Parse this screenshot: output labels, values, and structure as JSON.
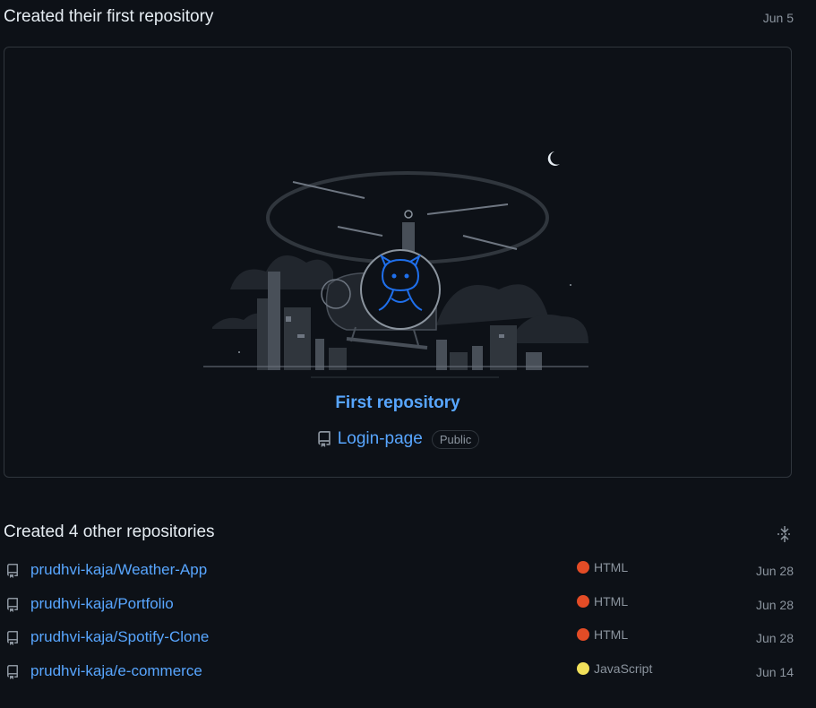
{
  "first_section": {
    "title": "Created their first repository",
    "date": "Jun 5",
    "card_title": "First repository",
    "repo_name": "Login-page",
    "badge": "Public"
  },
  "other_section": {
    "title": "Created 4 other repositories",
    "repos": [
      {
        "name": "prudhvi-kaja/Weather-App",
        "language": "HTML",
        "lang_color": "#e34c26",
        "date": "Jun 28"
      },
      {
        "name": "prudhvi-kaja/Portfolio",
        "language": "HTML",
        "lang_color": "#e34c26",
        "date": "Jun 28"
      },
      {
        "name": "prudhvi-kaja/Spotify-Clone",
        "language": "HTML",
        "lang_color": "#e34c26",
        "date": "Jun 28"
      },
      {
        "name": "prudhvi-kaja/e-commerce",
        "language": "JavaScript",
        "lang_color": "#f1e05a",
        "date": "Jun 14"
      }
    ]
  },
  "icons": {
    "repo": "repo-book-icon",
    "collapse": "fold-icon"
  }
}
